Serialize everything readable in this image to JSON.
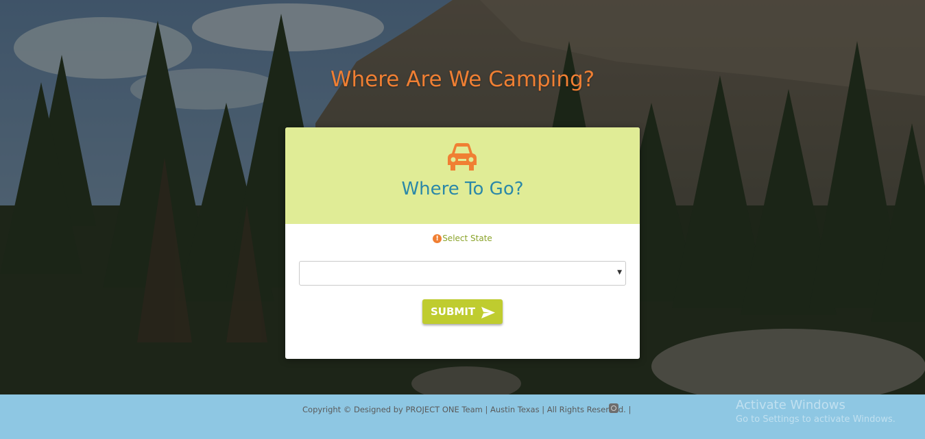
{
  "page": {
    "heading": "Where Are We Camping?"
  },
  "form_card": {
    "icon": "car-icon",
    "title": "Where To Go?",
    "state_label": "Select State",
    "state_label_icon": "exclamation-circle-icon",
    "state_select_value": "",
    "submit_label": "SUBMIT",
    "submit_icon": "send-icon"
  },
  "footer": {
    "copyright": "Copyright © Designed by PROJECT ONE Team | Austin Texas | All Rights Reserved. |",
    "icon": "github-icon"
  },
  "watermark": {
    "line1": "Activate Windows",
    "line2": "Go to Settings to activate Windows."
  },
  "colors": {
    "accent_orange": "#f07f33",
    "card_header": "#e0ec96",
    "card_title": "#2b88a8",
    "submit_green": "#bfcc2f",
    "footer_blue": "#8ec7e3"
  }
}
